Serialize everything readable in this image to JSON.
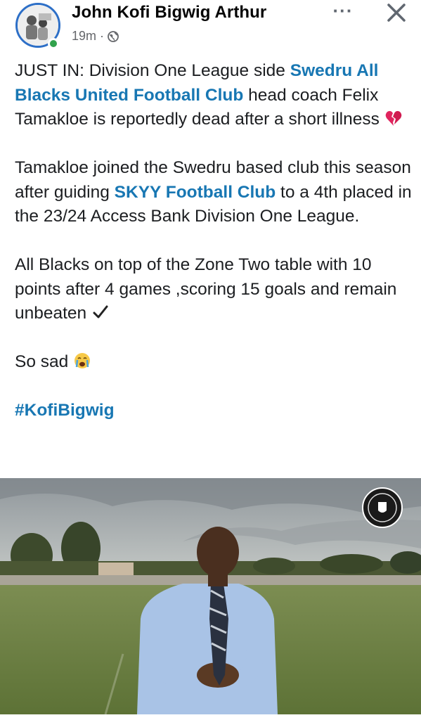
{
  "header": {
    "author": "John Kofi Bigwig Arthur",
    "time": "19m",
    "separator": "·",
    "more_label": "···",
    "audience_icon": "globe-icon",
    "close_icon": "close-icon"
  },
  "post": {
    "p1_a": "JUST IN: Division One League side ",
    "p1_link": "Swedru All Blacks United Football Club",
    "p1_b": " head coach Felix Tamakloe is reportedly dead after a short illness ",
    "p1_emoji": "broken-heart-emoji",
    "p2_a": "Tamakloe joined the Swedru based club this season after guiding ",
    "p2_link": "SKYY Football Club",
    "p2_b": " to a 4th placed in the 23/24 Access Bank Division One League.",
    "p3": "All Blacks on top of the Zone Two table with 10 points after 4 games ,scoring 15 goals and remain unbeaten ",
    "p3_emoji": "check-mark-emoji",
    "p4": "So sad ",
    "p4_emoji": "crying-face-emoji",
    "hashtag": "#KofiBigwig"
  },
  "photo": {
    "subject": "man-in-blue-shirt-on-football-pitch",
    "logo": "club-crest-icon"
  },
  "colors": {
    "link": "#1877b3",
    "online": "#31a24c",
    "avatar_ring": "#2d6fc7",
    "meta": "#65676b"
  }
}
